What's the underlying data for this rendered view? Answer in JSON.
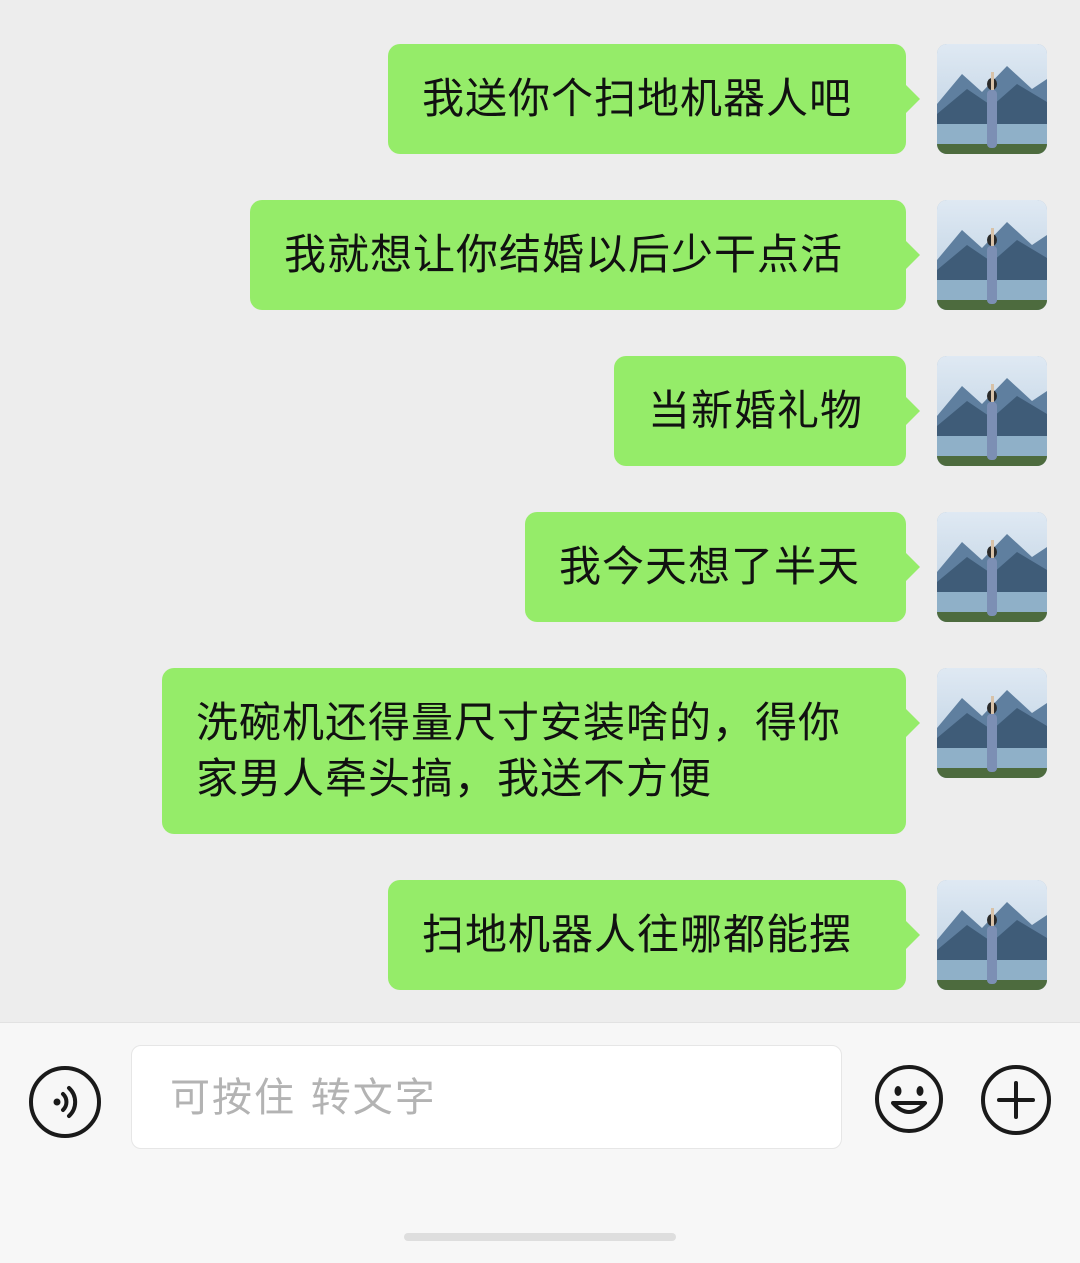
{
  "messages": [
    {
      "text": "我送你个扫地机器人吧"
    },
    {
      "text": "我就想让你结婚以后少干点活"
    },
    {
      "text": "当新婚礼物"
    },
    {
      "text": "我今天想了半天"
    },
    {
      "lines": [
        "洗碗机还得量尺寸安装啥的，得你",
        "家男人牵头搞，我送不方便"
      ]
    },
    {
      "text": "扫地机器人往哪都能摆"
    }
  ],
  "input": {
    "placeholder": "可按住 转文字"
  },
  "icons": {
    "voice": "voice-icon",
    "emoji": "emoji-icon",
    "plus": "plus-icon",
    "avatar": "avatar-photo"
  },
  "colors": {
    "bubble": "#95ec69",
    "background": "#ededed",
    "toolbar": "#f7f7f7"
  }
}
